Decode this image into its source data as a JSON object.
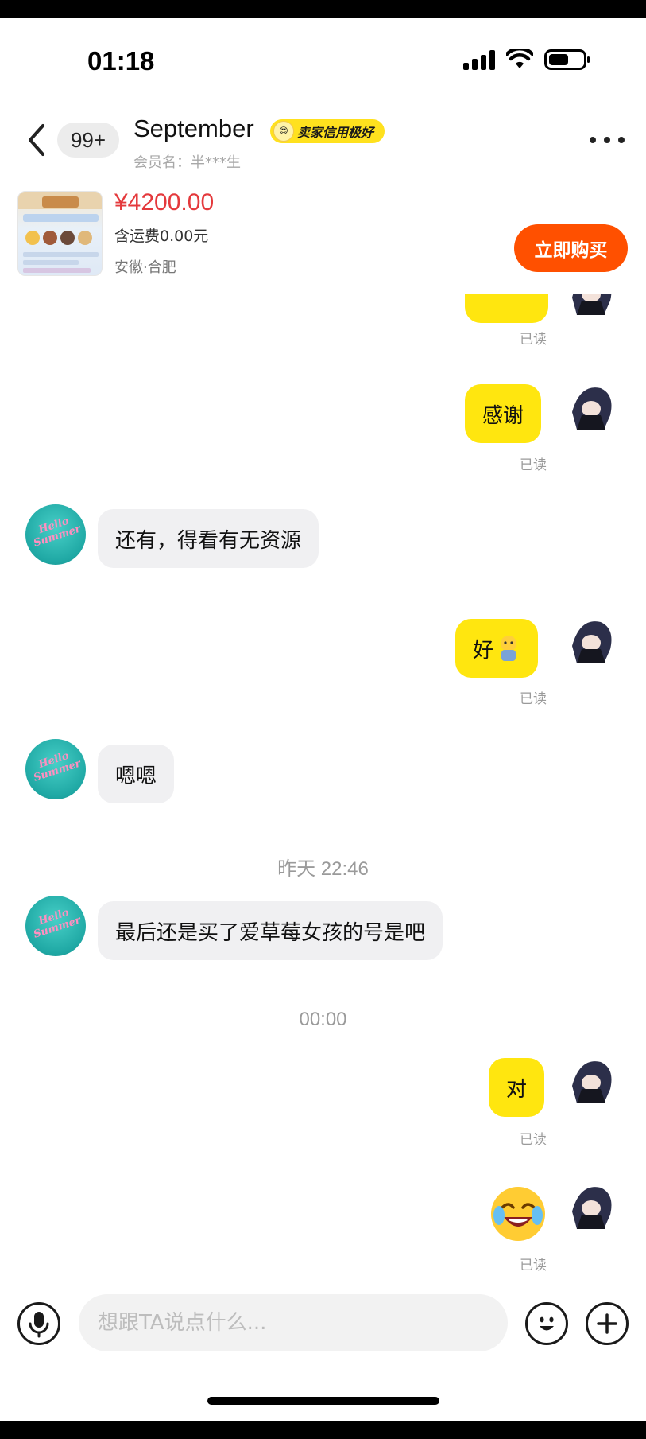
{
  "status_bar": {
    "time": "01:18",
    "icons": [
      "signal-icon",
      "wifi-icon",
      "battery-icon"
    ]
  },
  "header": {
    "back_icon": "chevron-left-icon",
    "unread_count": "99+",
    "contact_name": "September",
    "credit_badge": "卖家信用极好",
    "member_name": "会员名：半***生",
    "more_icon": "more-dots-icon"
  },
  "product": {
    "price": "¥4200.00",
    "shipping": "含运费0.00元",
    "location": "安徽·合肥",
    "buy_label": "立即购买"
  },
  "messages": [
    {
      "from": "me",
      "text": "",
      "partial": true,
      "status": "已读"
    },
    {
      "from": "me",
      "text": "感谢",
      "status": "已读"
    },
    {
      "from": "them",
      "text": "还有，得看有无资源"
    },
    {
      "from": "me",
      "text": "好",
      "sticker": "small-emoji-sticker",
      "status": "已读"
    },
    {
      "from": "them",
      "text": "嗯嗯"
    },
    {
      "type": "timestamp",
      "text": "昨天 22:46"
    },
    {
      "from": "them",
      "text": "最后还是买了爱草莓女孩的号是吧"
    },
    {
      "type": "timestamp",
      "text": "00:00"
    },
    {
      "from": "me",
      "text": "对",
      "status": "已读"
    },
    {
      "from": "me",
      "sticker": "laughing-crying-emoji",
      "status": "已读"
    }
  ],
  "input_bar": {
    "voice_icon": "microphone-icon",
    "placeholder": "想跟TA说点什么...",
    "emoji_icon": "smiley-icon",
    "plus_icon": "plus-icon"
  },
  "colors": {
    "accent_yellow": "#ffe60f",
    "buy_orange": "#ff5000",
    "price_red": "#e4393c",
    "incoming_bubble": "#f0f0f2"
  }
}
